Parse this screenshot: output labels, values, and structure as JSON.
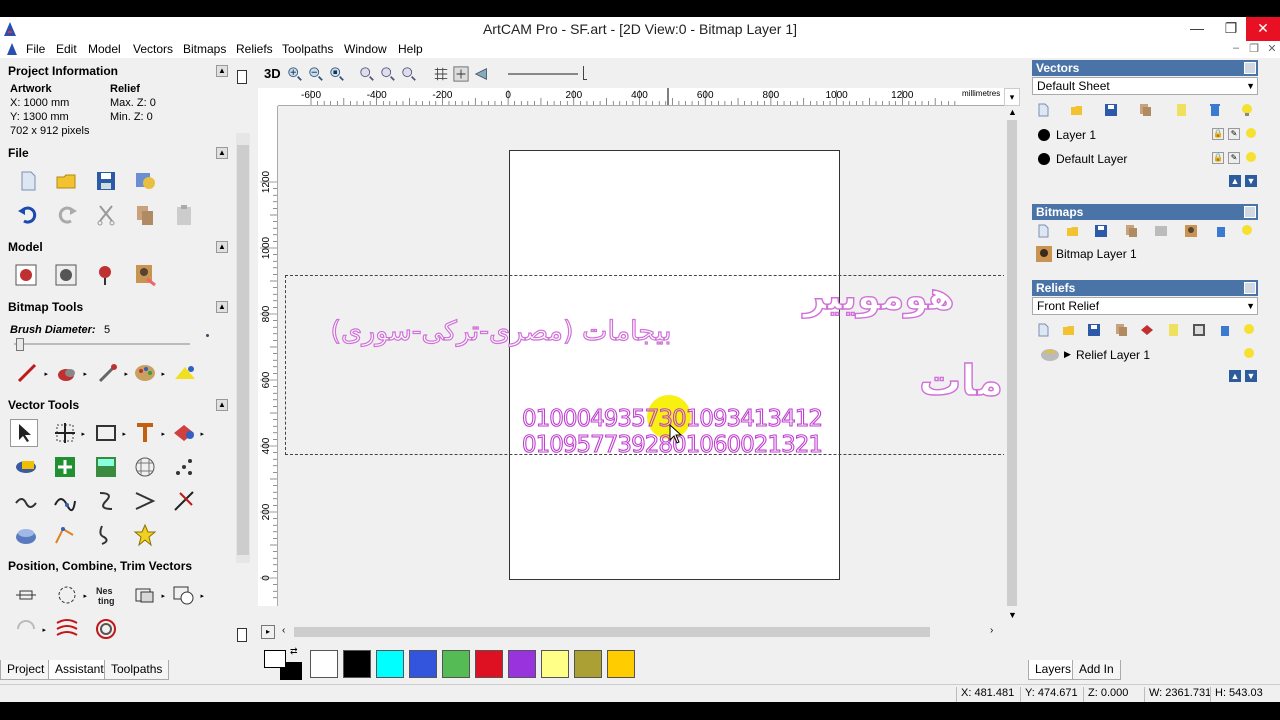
{
  "window": {
    "title": "ArtCAM Pro - SF.art - [2D View:0 - Bitmap Layer 1]",
    "minimize": "—",
    "maximize": "❐",
    "close": "✕"
  },
  "menu": [
    "File",
    "Edit",
    "Model",
    "Vectors",
    "Bitmaps",
    "Reliefs",
    "Toolpaths",
    "Window",
    "Help"
  ],
  "left": {
    "project_info": {
      "header": "Project Information",
      "artwork_label": "Artwork",
      "relief_label": "Relief",
      "x": "X: 1000 mm",
      "y": "Y: 1300 mm",
      "pixels": "702 x 912 pixels",
      "max_z": "Max. Z: 0",
      "min_z": "Min. Z: 0"
    },
    "file_header": "File",
    "model_header": "Model",
    "bitmap_header": "Bitmap Tools",
    "brush_label": "Brush Diameter:",
    "brush_value": "5",
    "vector_header": "Vector Tools",
    "position_header": "Position, Combine, Trim Vectors",
    "tabs": [
      "Project",
      "Assistant",
      "Toolpaths"
    ]
  },
  "view": {
    "toolbar_3d": "3D",
    "ruler_h_labels": [
      "-600",
      "-400",
      "-200",
      "0",
      "200",
      "400",
      "600",
      "800",
      "1000",
      "1200"
    ],
    "ruler_unit": "millimetres",
    "ruler_v_labels": [
      "1200",
      "1000",
      "800",
      "600",
      "400",
      "200",
      "0"
    ],
    "arabic_line1": "بيجامات (مصرى-تركى-سورى)",
    "arabic_line2": "هومويير",
    "arabic_line3": "بيجامات",
    "phone1": "01000493573",
    "phone2": "01093413412",
    "phone3": "01095773928",
    "phone4": "01060021321"
  },
  "palette": [
    "#ffffff",
    "#000000",
    "#00ffff",
    "#3355dd",
    "#55bb55",
    "#dd1122",
    "#9933dd",
    "#ffff88",
    "#aaa033",
    "#ffcc00"
  ],
  "right": {
    "vectors_header": "Vectors",
    "vectors_sheet": "Default Sheet",
    "layers": [
      "Layer 1",
      "Default Layer"
    ],
    "bitmaps_header": "Bitmaps",
    "bitmap_layer": "Bitmap Layer 1",
    "reliefs_header": "Reliefs",
    "relief_select": "Front Relief",
    "relief_layer": "Relief Layer 1",
    "tabs": [
      "Layers",
      "Add In"
    ]
  },
  "status": {
    "x": "X: 481.481",
    "y": "Y: 474.671",
    "z": "Z: 0.000",
    "w": "W: 2361.731",
    "h": "H: 543.03"
  }
}
